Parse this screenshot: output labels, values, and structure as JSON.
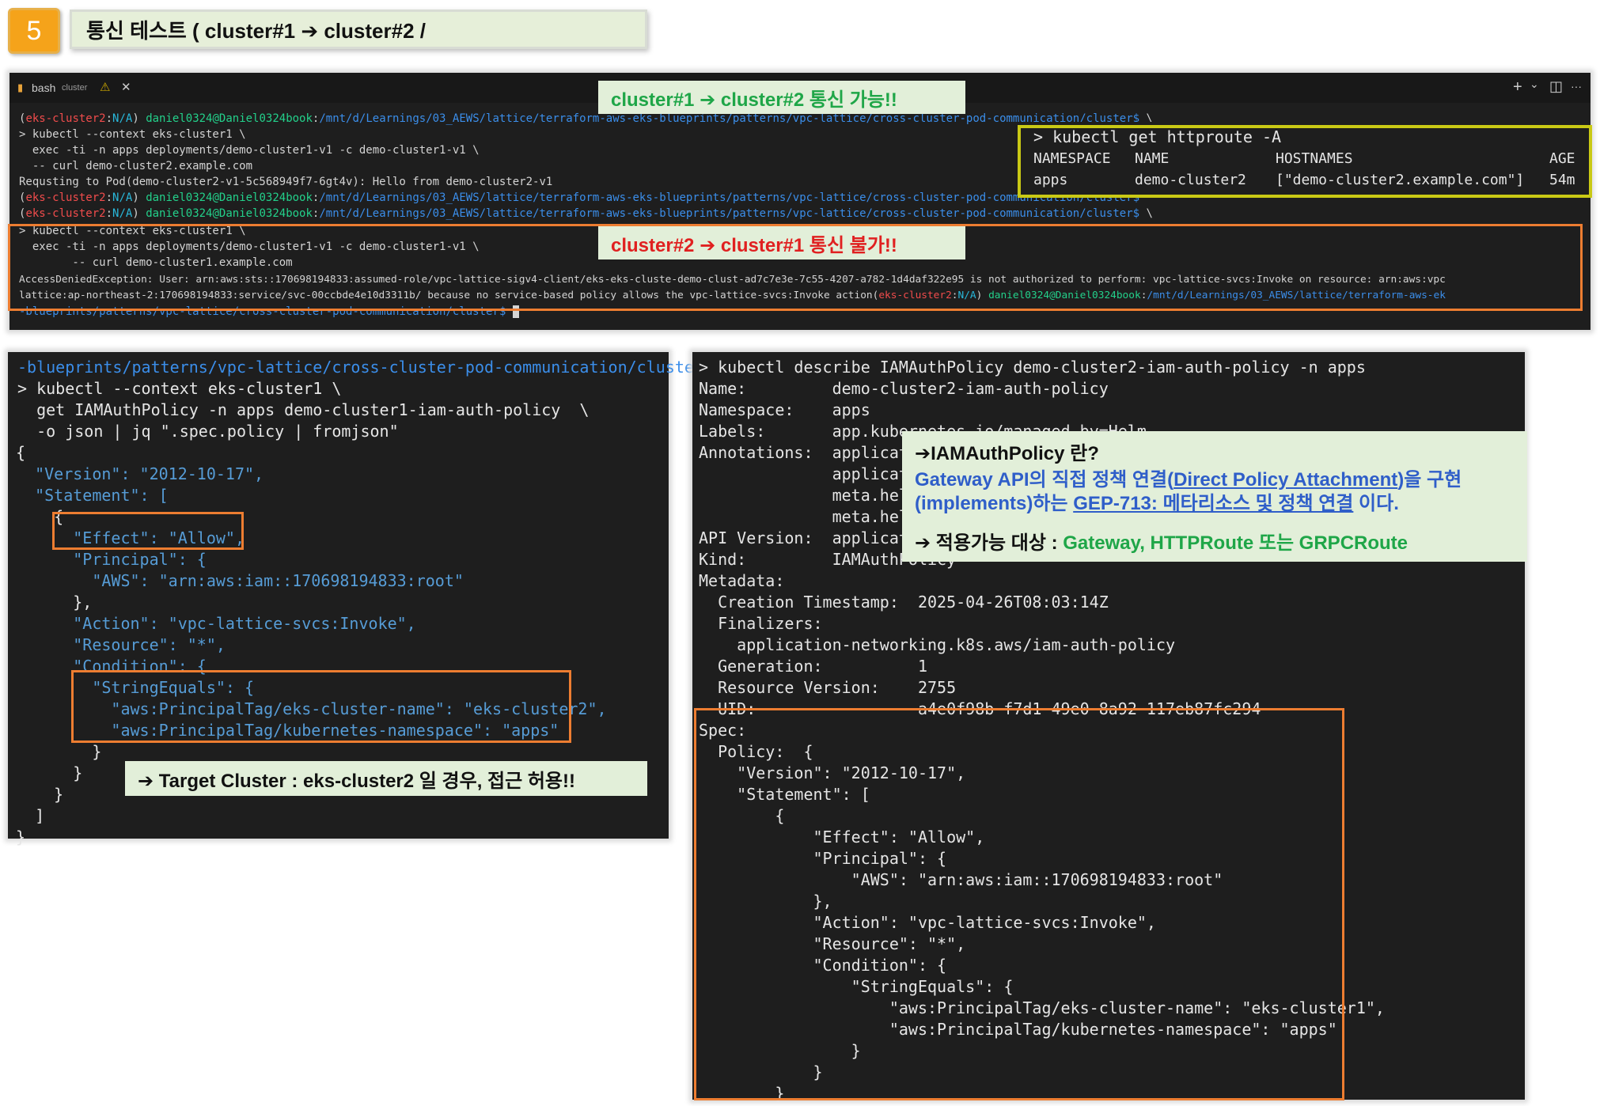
{
  "step": {
    "number": "5",
    "title": "통신 테스트 ( cluster#1 ➔ cluster#2 /"
  },
  "top_terminal": {
    "tab_label": "bash",
    "tab_sublabel": "cluster",
    "tab_warning": "⚠",
    "tab_close": "✕",
    "action_add": "+",
    "action_chevron": "⌄",
    "action_split": "◫",
    "action_more": "···",
    "prompt": {
      "ctx": "eks-cluster2",
      "ns": "N/A",
      "user": "daniel0324@Daniel0324book",
      "path": "/mnt/d/Learnings/03_AEWS/lattice/terraform-aws-eks-blueprints/patterns/vpc-lattice/cross-cluster-pod-communication/cluster$",
      "cont": " \\"
    },
    "lines": [
      "> kubectl --context eks-cluster1 \\",
      "  exec -ti -n apps deployments/demo-cluster1-v1 -c demo-cluster1-v1 \\",
      "  -- curl demo-cluster2.example.com",
      "Requsting to Pod(demo-cluster2-v1-5c568949f7-6gt4v): Hello from demo-cluster2-v1",
      "> kubectl --context eks-cluster1 \\",
      "  exec -ti -n apps deployments/demo-cluster1-v1 -c demo-cluster1-v1 \\",
      "        -- curl demo-cluster1.example.com",
      "AccessDeniedException: User: arn:aws:sts::170698194833:assumed-role/vpc-lattice-sigv4-client/eks-eks-cluste-demo-clust-ad7c7e3e-7c55-4207-a782-1d4daf322e95 is not authorized to perform: vpc-lattice-svcs:Invoke on resource: arn:aws:vpc",
      "lattice:ap-northeast-2:170698194833:service/svc-00ccbde4e10d3311b/ because no service-based policy allows the vpc-lattice-svcs:Invoke action",
      "-blueprints/patterns/vpc-lattice/cross-cluster-pod-communication/cluster$",
      "/mnt/d/Learnings/03_AEWS/lattice/terraform-aws-ek"
    ],
    "httproute": {
      "command": "> kubectl get httproute -A",
      "headers": [
        "NAMESPACE",
        "NAME",
        "HOSTNAMES",
        "AGE"
      ],
      "row": [
        "apps",
        "demo-cluster2",
        "[\"demo-cluster2.example.com\"]",
        "54m"
      ]
    },
    "callout_ok": "cluster#1 ➔ cluster#2 통신 가능!!",
    "callout_fail": "cluster#2 ➔ cluster#1 통신 불가!!"
  },
  "left_terminal": {
    "path_line": "-blueprints/patterns/vpc-lattice/cross-cluster-pod-communication/cluster$ \\",
    "cmd": [
      "> kubectl --context eks-cluster1 \\",
      "  get IAMAuthPolicy -n apps demo-cluster1-iam-auth-policy  \\",
      "  -o json | jq \".spec.policy | fromjson\""
    ],
    "json": [
      "{",
      "  \"Version\": \"2012-10-17\",",
      "  \"Statement\": [",
      "    {",
      "      \"Effect\": \"Allow\",",
      "      \"Principal\": {",
      "        \"AWS\": \"arn:aws:iam::170698194833:root\"",
      "      },",
      "      \"Action\": \"vpc-lattice-svcs:Invoke\",",
      "      \"Resource\": \"*\",",
      "      \"Condition\": {",
      "        \"StringEquals\": {",
      "          \"aws:PrincipalTag/eks-cluster-name\": \"eks-cluster2\",",
      "          \"aws:PrincipalTag/kubernetes-namespace\": \"apps\"",
      "        }",
      "      }",
      "    }",
      "  ]",
      "}"
    ],
    "callout": "➔  Target Cluster : eks-cluster2 일 경우, 접근 허용!!"
  },
  "right_terminal": {
    "lines": [
      "> kubectl describe IAMAuthPolicy demo-cluster2-iam-auth-policy -n apps",
      "Name:         demo-cluster2-iam-auth-policy",
      "Namespace:    apps",
      "Labels:       app.kubernetes.io/managed-by=Helm",
      "Annotations:  applicati",
      "              applicati",
      "              meta.helm",
      "              meta.helm",
      "API Version:  applicati",
      "Kind:         IAMAuthPolicy",
      "Metadata:",
      "  Creation Timestamp:  2025-04-26T08:03:14Z",
      "  Finalizers:",
      "    application-networking.k8s.aws/iam-auth-policy",
      "  Generation:          1",
      "  Resource Version:    2755",
      "  UID:                 a4e0f98b-f7d1-49e0-8a92-117eb87fc294",
      "Spec:",
      "  Policy:  {",
      "    \"Version\": \"2012-10-17\",",
      "    \"Statement\": [",
      "        {",
      "            \"Effect\": \"Allow\",",
      "            \"Principal\": {",
      "                \"AWS\": \"arn:aws:iam::170698194833:root\"",
      "            },",
      "            \"Action\": \"vpc-lattice-svcs:Invoke\",",
      "            \"Resource\": \"*\",",
      "            \"Condition\": {",
      "                \"StringEquals\": {",
      "                    \"aws:PrincipalTag/eks-cluster-name\": \"eks-cluster1\",",
      "                    \"aws:PrincipalTag/kubernetes-namespace\": \"apps\"",
      "                }",
      "            }",
      "        }"
    ],
    "info": {
      "title": "➔IAMAuthPolicy 란?",
      "desc_a": "Gateway API의 직접 정책 연결(",
      "desc_link1": "Direct Policy Attachment",
      "desc_b": ")을 구현",
      "desc_c": "(implements)하는 ",
      "desc_link2": "GEP-713: 메타리소스 및 정책 연결",
      "desc_d": " 이다.",
      "target_label": "➔  적용가능 대상 : ",
      "target_value": "Gateway, HTTPRoute 또는 GRPCRoute"
    }
  },
  "colors": {
    "badge": "#f5a31a",
    "callout_bg": "#e2efd9",
    "highlight_orange": "#ed7d31",
    "highlight_yellow": "#c9c915",
    "ok_green": "#1fa648",
    "fail_red": "#e02020",
    "terminal_bg": "#1e1e1e"
  }
}
